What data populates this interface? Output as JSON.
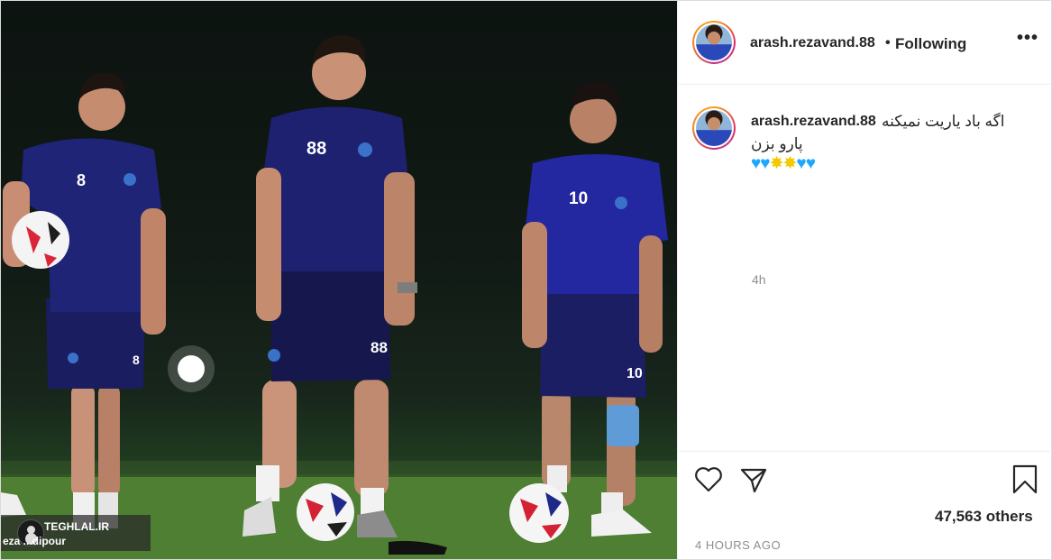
{
  "photo": {
    "credit_site": "TEGHLAL.IR",
    "credit_name": "eza ...dipour",
    "players": [
      {
        "number": "8"
      },
      {
        "number": "88"
      },
      {
        "number": "10"
      }
    ]
  },
  "header": {
    "username": "arash.rezavand.88",
    "separator": "•",
    "follow_status": "Following",
    "more_label": "•••"
  },
  "caption": {
    "username": "arash.rezavand.88",
    "line1": "اگه باد یاریت نمیکنه",
    "line2": "پارو بزن",
    "emojis": [
      "blue-heart",
      "blue-heart",
      "star",
      "star",
      "blue-heart",
      "blue-heart"
    ],
    "age": "4h"
  },
  "footer": {
    "likes_text": "47,563 others",
    "timestamp": "4 HOURS AGO"
  },
  "colors": {
    "accent_text": "#262626",
    "muted_text": "#8e8e8e",
    "border": "#dbdbdb",
    "heart_blue": "#1ea7ff",
    "kit_blue": "#1c1f6b"
  }
}
